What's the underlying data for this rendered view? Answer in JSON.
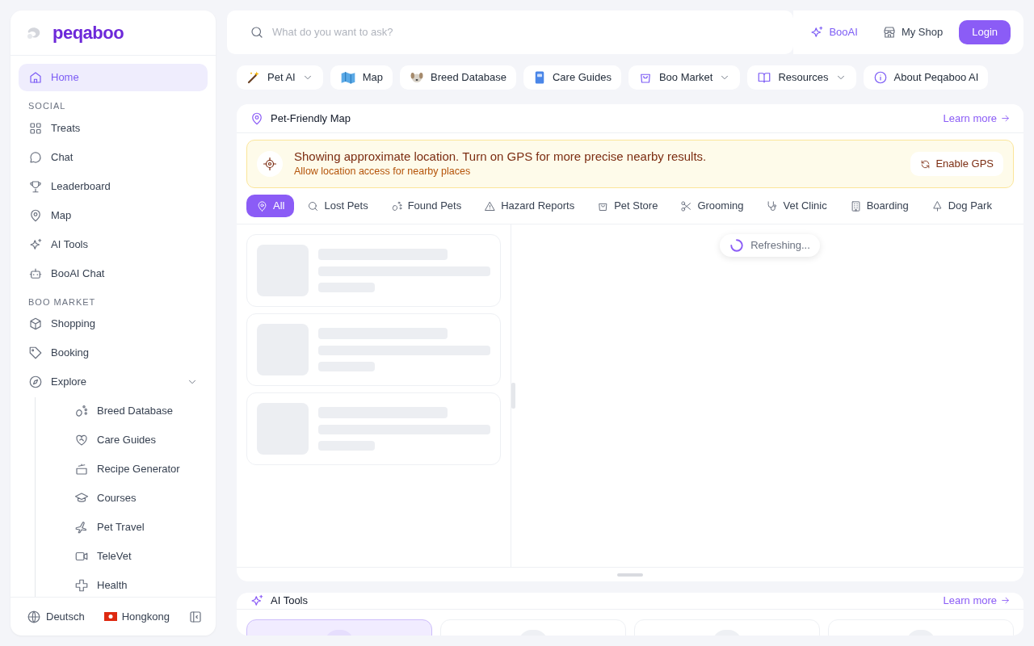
{
  "logo": {
    "text": "peqaboo"
  },
  "sidebar": {
    "sections": [
      {
        "items": [
          {
            "label": "Home",
            "selected": true
          }
        ]
      },
      {
        "heading": "SOCIAL",
        "items": [
          {
            "label": "Treats",
            "selected": false
          },
          {
            "label": "Chat",
            "selected": false
          },
          {
            "label": "Leaderboard",
            "selected": false
          },
          {
            "label": "Map",
            "selected": false
          },
          {
            "label": "AI Tools",
            "selected": false
          },
          {
            "label": "BooAI Chat",
            "selected": false
          }
        ]
      },
      {
        "heading": "BOO MARKET",
        "items": [
          {
            "label": "Shopping",
            "selected": false
          },
          {
            "label": "Booking",
            "selected": false
          },
          {
            "label": "Explore",
            "selected": false,
            "expanded": true,
            "children": [
              {
                "label": "Breed Database",
                "selected": false
              },
              {
                "label": "Care Guides",
                "selected": false
              },
              {
                "label": "Recipe Generator",
                "selected": false
              },
              {
                "label": "Courses",
                "selected": false
              },
              {
                "label": "Pet Travel",
                "selected": false
              },
              {
                "label": "TeleVet",
                "selected": false
              },
              {
                "label": "Health",
                "selected": false
              }
            ]
          }
        ]
      }
    ],
    "footer": {
      "language": "Deutsch",
      "region": "Hongkong"
    }
  },
  "search": {
    "placeholder": "What do you want to ask?"
  },
  "header_links": [
    {
      "label": "BooAI",
      "kind": "accent"
    },
    {
      "label": "My Shop",
      "kind": "plain"
    }
  ],
  "login_button": "Login",
  "nav_chips": [
    {
      "label": "Pet AI",
      "dropdown": true
    },
    {
      "label": "Map",
      "dropdown": false
    },
    {
      "label": "Breed Database",
      "dropdown": false
    },
    {
      "label": "Care Guides",
      "dropdown": false
    },
    {
      "label": "Boo Market",
      "dropdown": true
    },
    {
      "label": "Resources",
      "dropdown": true
    },
    {
      "label": "About Peqaboo AI",
      "dropdown": false
    }
  ],
  "map_panel": {
    "title": "Pet-Friendly Map",
    "learn_more": "Learn more",
    "notice": {
      "message": "Showing approximate location. Turn on GPS for more precise nearby results.",
      "hint": "Allow location access for nearby places",
      "button": "Enable GPS"
    },
    "categories": [
      {
        "label": "All",
        "selected": true
      },
      {
        "label": "Lost Pets",
        "selected": false
      },
      {
        "label": "Found Pets",
        "selected": false
      },
      {
        "label": "Hazard Reports",
        "selected": false
      },
      {
        "label": "Pet Store",
        "selected": false
      },
      {
        "label": "Grooming",
        "selected": false
      },
      {
        "label": "Vet Clinic",
        "selected": false
      },
      {
        "label": "Boarding",
        "selected": false
      },
      {
        "label": "Dog Park",
        "selected": false
      }
    ],
    "status": "Refreshing..."
  },
  "ai_tools": {
    "title": "AI Tools",
    "learn_more": "Learn more",
    "tool_cards": [
      {
        "selected": true
      },
      {
        "selected": false
      },
      {
        "selected": false
      },
      {
        "selected": false
      }
    ]
  }
}
